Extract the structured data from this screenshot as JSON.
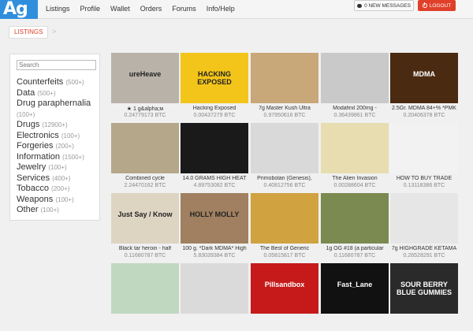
{
  "logo": "Ag",
  "nav": [
    "Listings",
    "Profile",
    "Wallet",
    "Orders",
    "Forums",
    "Info/Help"
  ],
  "messages_label": "0 NEW MESSAGES",
  "logout_label": "LOGOUT",
  "breadcrumb": "LISTINGS",
  "breadcrumb_sep": ">",
  "search": {
    "placeholder": "Search"
  },
  "categories": [
    {
      "name": "Counterfeits",
      "count": "(500+)"
    },
    {
      "name": "Data",
      "count": "(500+)"
    },
    {
      "name": "Drug paraphernalia",
      "count": "(100+)"
    },
    {
      "name": "Drugs",
      "count": "(12900+)"
    },
    {
      "name": "Electronics",
      "count": "(100+)"
    },
    {
      "name": "Forgeries",
      "count": "(200+)"
    },
    {
      "name": "Information",
      "count": "(1500+)"
    },
    {
      "name": "Jewelry",
      "count": "(100+)"
    },
    {
      "name": "Services",
      "count": "(400+)"
    },
    {
      "name": "Tobacco",
      "count": "(200+)"
    },
    {
      "name": "Weapons",
      "count": "(100+)"
    },
    {
      "name": "Other",
      "count": "(100+)"
    }
  ],
  "listings": [
    {
      "title": "★ 1 g&alpha;м",
      "price": "0.24779173 BTC",
      "thumb_text": "ureHeave",
      "color": "#b9b2a8"
    },
    {
      "title": "Hacking Exposed",
      "price": "0.00437279 BTC",
      "thumb_text": "HACKING EXPOSED",
      "color": "#f3c51a"
    },
    {
      "title": "7g Master Kush Ultra",
      "price": "0.97950616 BTC",
      "thumb_text": "",
      "color": "#c8a878"
    },
    {
      "title": "Modafinil 200mg -",
      "price": "0.36439861 BTC",
      "thumb_text": "",
      "color": "#c9c9c9"
    },
    {
      "title": "2.5Gr. MDMA 84+% *PMK",
      "price": "0.20406378 BTC",
      "thumb_text": "MDMA",
      "color": "#4a2a10"
    },
    {
      "title": "Combined cycle",
      "price": "2.24470162 BTC",
      "thumb_text": "",
      "color": "#b5a78a"
    },
    {
      "title": "14.0 GRAMS HIGH HEAT",
      "price": "4.89753082 BTC",
      "thumb_text": "",
      "color": "#1a1a1a"
    },
    {
      "title": "Primobolan (Genesis),",
      "price": "0.40812756 BTC",
      "thumb_text": "",
      "color": "#d9d9d9"
    },
    {
      "title": "The Alien Invasion",
      "price": "0.00288604 BTC",
      "thumb_text": "",
      "color": "#e8ddb0"
    },
    {
      "title": "HOW TO BUY TRADE",
      "price": "0.13118386 BTC",
      "thumb_text": "",
      "color": "#f2f2f2"
    },
    {
      "title": "Black tar heroin - half",
      "price": "0.11680787 BTC",
      "thumb_text": "Just Say / Know",
      "color": "#ddd4c2"
    },
    {
      "title": "100 g. *Dark MDMA* High",
      "price": "5.83039384 BTC",
      "thumb_text": "HOLLY MOLLY",
      "color": "#a08060"
    },
    {
      "title": "The Best of Generic",
      "price": "0.05815817 BTC",
      "thumb_text": "",
      "color": "#d0a240"
    },
    {
      "title": "1g OG #18 (a particular",
      "price": "0.11680787 BTC",
      "thumb_text": "",
      "color": "#7a8a50"
    },
    {
      "title": "7g HIGHGRADE KETAMA",
      "price": "0.26528291 BTC",
      "thumb_text": "",
      "color": "#e6e6e6"
    },
    {
      "title": "",
      "price": "",
      "thumb_text": "",
      "color": "#c0d8c0"
    },
    {
      "title": "",
      "price": "",
      "thumb_text": "",
      "color": "#dadada"
    },
    {
      "title": "",
      "price": "",
      "thumb_text": "Pillsandbox",
      "color": "#c61a1a"
    },
    {
      "title": "",
      "price": "",
      "thumb_text": "Fast_Lane",
      "color": "#111111"
    },
    {
      "title": "",
      "price": "",
      "thumb_text": "SOUR BERRY BLUE GUMMIES",
      "color": "#2a2a2a"
    }
  ]
}
